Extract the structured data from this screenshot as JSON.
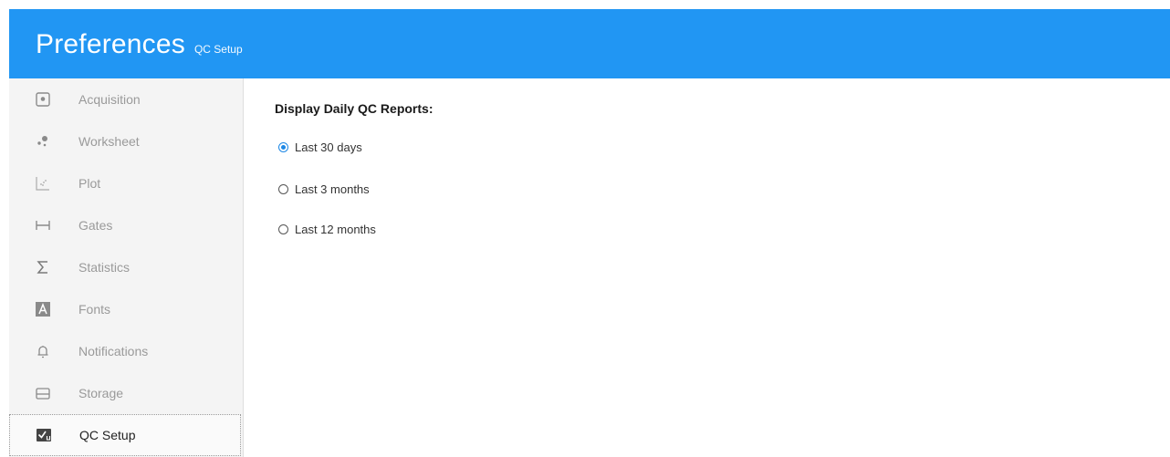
{
  "header": {
    "title": "Preferences",
    "subtitle": "QC Setup"
  },
  "sidebar": {
    "items": [
      {
        "label": "Acquisition",
        "icon": "acquisition-icon"
      },
      {
        "label": "Worksheet",
        "icon": "worksheet-icon"
      },
      {
        "label": "Plot",
        "icon": "plot-icon"
      },
      {
        "label": "Gates",
        "icon": "gates-icon"
      },
      {
        "label": "Statistics",
        "icon": "sigma-icon"
      },
      {
        "label": "Fonts",
        "icon": "font-icon"
      },
      {
        "label": "Notifications",
        "icon": "bell-icon"
      },
      {
        "label": "Storage",
        "icon": "storage-icon"
      },
      {
        "label": "QC Setup",
        "icon": "qc-setup-icon",
        "active": true
      }
    ]
  },
  "main": {
    "heading": "Display Daily QC Reports:",
    "options": [
      {
        "label": "Last 30 days",
        "checked": true
      },
      {
        "label": "Last 3 months",
        "checked": false
      },
      {
        "label": "Last 12 months",
        "checked": false
      }
    ]
  },
  "colors": {
    "header_bg": "#2196f3",
    "radio_accent": "#1e88e5",
    "sidebar_bg": "#f4f4f4"
  }
}
